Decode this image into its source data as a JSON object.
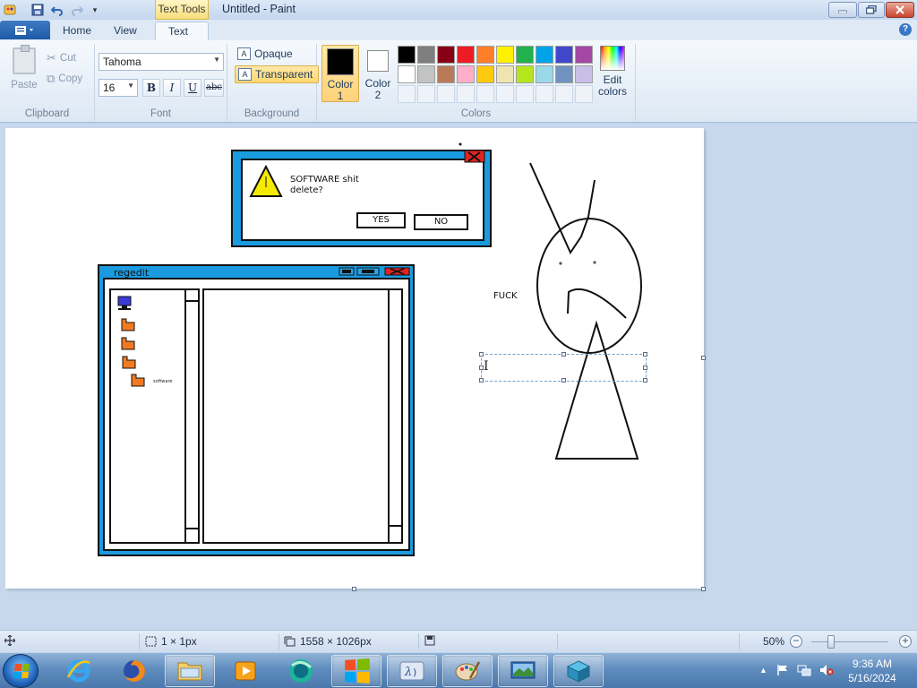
{
  "window": {
    "title": "Untitled - Paint",
    "context_tab": "Text Tools",
    "controls": {
      "minimize": "—",
      "maximize": "❐",
      "close": "✕"
    }
  },
  "quick_access": {
    "icons": [
      "paint-app-icon",
      "save-icon",
      "undo-icon",
      "redo-icon",
      "customize-icon"
    ]
  },
  "tabs": [
    {
      "label": "Home",
      "active": false
    },
    {
      "label": "View",
      "active": false
    },
    {
      "label": "Text",
      "active": true
    }
  ],
  "ribbon": {
    "clipboard": {
      "paste": "Paste",
      "cut": "Cut",
      "copy": "Copy",
      "label": "Clipboard"
    },
    "font": {
      "family": "Tahoma",
      "size": "16",
      "bold": "B",
      "italic": "I",
      "underline": "U",
      "strike": "abc",
      "label": "Font"
    },
    "background": {
      "opaque": "Opaque",
      "transparent": "Transparent",
      "selected": "transparent",
      "label": "Background"
    },
    "colors": {
      "color1_label": "Color\n1",
      "color1_line1": "Color",
      "color1_line2": "1",
      "color2_line1": "Color",
      "color2_line2": "2",
      "color1": "#000000",
      "color2": "#ffffff",
      "edit_line1": "Edit",
      "edit_line2": "colors",
      "label": "Colors",
      "palette": [
        "#000000",
        "#7f7f7f",
        "#880015",
        "#ed1c24",
        "#ff7f27",
        "#fff200",
        "#22b14c",
        "#00a2e8",
        "#3f48cc",
        "#a349a4",
        "#ffffff",
        "#c3c3c3",
        "#b97a57",
        "#ffaec9",
        "#ffc90e",
        "#efe4b0",
        "#b5e61d",
        "#99d9ea",
        "#7092be",
        "#c8bfe7"
      ],
      "empty_slots": 10
    }
  },
  "canvas": {
    "dialog": {
      "message_line1": "SOFTWARE shit",
      "message_line2": "delete?",
      "yes": "YES",
      "no": "NO",
      "close_glyph": "X"
    },
    "regedit": {
      "title": "regedit",
      "tree_label": "software"
    },
    "doodle_text": "FUCK",
    "text_cursor": "I"
  },
  "statusbar": {
    "selection_size": "1 × 1px",
    "canvas_size": "1558 × 1026px",
    "zoom": "50%",
    "zoom_level": 0.5
  },
  "taskbar": {
    "apps": [
      "internet-explorer-icon",
      "firefox-icon",
      "explorer-folder-icon",
      "media-player-icon",
      "browser-app-icon",
      "windows-update-icon",
      "xampp-icon",
      "paint-icon",
      "screen-capture-icon",
      "package-icon"
    ],
    "time": "9:36 AM",
    "date": "5/16/2024"
  }
}
